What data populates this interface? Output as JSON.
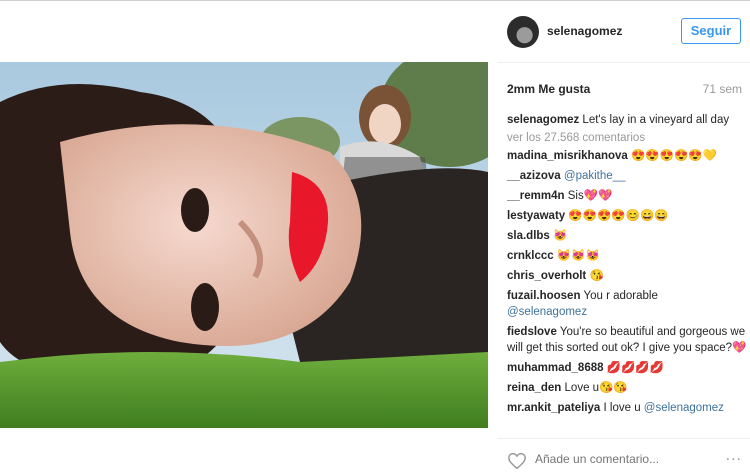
{
  "post": {
    "username": "selenagomez",
    "follow_label": "Seguir",
    "likes": "2mm Me gusta",
    "age": "71 sem",
    "caption": {
      "user": "selenagomez",
      "text": " Let's lay in a vineyard all day"
    },
    "view_all": "ver los 27.568 comentarios",
    "comments": [
      {
        "user": "madina_misrikhanova",
        "text": " 😍😍😍😍😍💛"
      },
      {
        "user": "__azizova",
        "mention": " @pakithe__",
        "text": ""
      },
      {
        "user": "__remm4n",
        "text": " Sis💖💖"
      },
      {
        "user": "lestyawaty",
        "text": " 😍😍😍😍😊😄😄"
      },
      {
        "user": "sla.dlbs",
        "text": " 😻"
      },
      {
        "user": "crnklccc",
        "text": " 😻😻😻"
      },
      {
        "user": "chris_overholt",
        "text": " 😘"
      },
      {
        "user": "fuzail.hoosen",
        "text": " You r adorable",
        "mention_after": "@selenagomez"
      },
      {
        "user": "fiedslove",
        "text": " You're so beautiful and gorgeous we will get this sorted out ok? I give you space?💖"
      },
      {
        "user": "muhammad_8688",
        "text": " 💋💋💋💋"
      },
      {
        "user": "reina_den",
        "text": " Love u😘😘"
      },
      {
        "user": "mr.ankit_pateliya",
        "text": " I love u",
        "mention_after": " @selenagomez"
      }
    ],
    "add_comment_placeholder": "Añade un comentario...",
    "more_dots": "..."
  },
  "icons": {
    "avatar": "profile-avatar",
    "like": "heart-outline-icon",
    "more": "more-options-icon"
  },
  "colors": {
    "accent": "#3897f0",
    "mention": "#3f729b",
    "lipstick": "#e8182a"
  }
}
